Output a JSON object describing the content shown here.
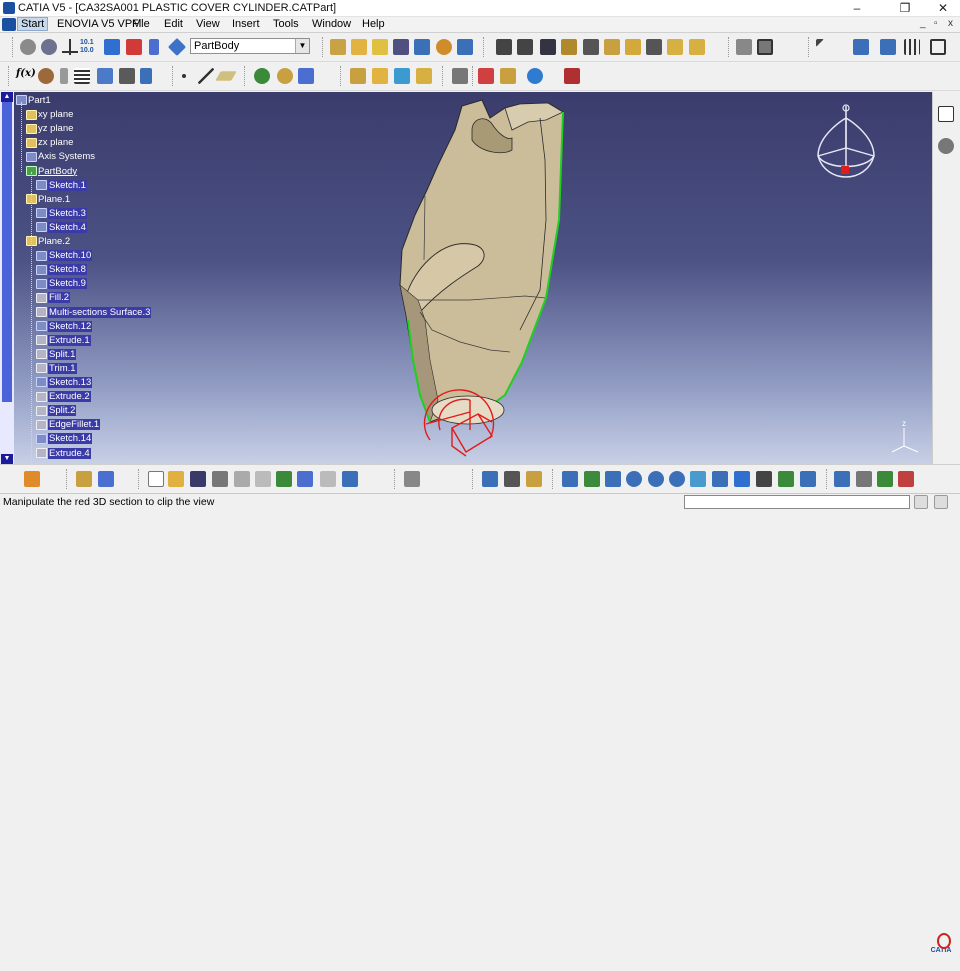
{
  "window": {
    "title": "CATIA V5 - [CA32SA001 PLASTIC COVER CYLINDER.CATPart]",
    "minimize": "–",
    "restore": "❐",
    "close": "✕",
    "mdi_minimize": "_",
    "mdi_restore": "▫",
    "mdi_close": "x"
  },
  "menu": {
    "items": [
      "Start",
      "ENOVIA V5 VPM",
      "File",
      "Edit",
      "View",
      "Insert",
      "Tools",
      "Window",
      "Help"
    ]
  },
  "toolbar": {
    "body_select_value": "PartBody",
    "fog_label": "f(x)"
  },
  "tree": {
    "nodes": [
      {
        "label": "Part1",
        "type": "root"
      },
      {
        "label": "xy plane",
        "type": "plane"
      },
      {
        "label": "yz plane",
        "type": "plane"
      },
      {
        "label": "zx plane",
        "type": "plane"
      },
      {
        "label": "Axis Systems",
        "type": "axis"
      },
      {
        "label": "PartBody",
        "type": "body"
      },
      {
        "label": "Sketch.1",
        "type": "sketch"
      },
      {
        "label": "Plane.1",
        "type": "plane"
      },
      {
        "label": "Sketch.3",
        "type": "sketch"
      },
      {
        "label": "Sketch.4",
        "type": "sketch"
      },
      {
        "label": "Plane.2",
        "type": "plane"
      },
      {
        "label": "Sketch.10",
        "type": "sketch"
      },
      {
        "label": "Sketch.8",
        "type": "sketch"
      },
      {
        "label": "Sketch.9",
        "type": "sketch"
      },
      {
        "label": "Fill.2",
        "type": "feat"
      },
      {
        "label": "Multi-sections Surface.3",
        "type": "feat"
      },
      {
        "label": "Sketch.12",
        "type": "sketch"
      },
      {
        "label": "Extrude.1",
        "type": "feat"
      },
      {
        "label": "Split.1",
        "type": "feat"
      },
      {
        "label": "Trim.1",
        "type": "feat"
      },
      {
        "label": "Sketch.13",
        "type": "sketch"
      },
      {
        "label": "Extrude.2",
        "type": "feat"
      },
      {
        "label": "Split.2",
        "type": "feat"
      },
      {
        "label": "EdgeFillet.1",
        "type": "feat"
      },
      {
        "label": "Sketch.14",
        "type": "sketch"
      },
      {
        "label": "Extrude.4",
        "type": "feat"
      }
    ]
  },
  "status": {
    "message": "Manipulate the red 3D section to clip the view"
  },
  "viewport": {
    "axis_label": "z",
    "compass_icon": "compass-icon"
  },
  "brand": {
    "logo_text": "CATIA"
  },
  "colors": {
    "viewport_top": "#3a3c6c",
    "viewport_bottom": "#c8d0e6",
    "part_fill": "#cbbd9a",
    "highlight_edge": "#1fd01f",
    "section": "#e21b1b"
  }
}
